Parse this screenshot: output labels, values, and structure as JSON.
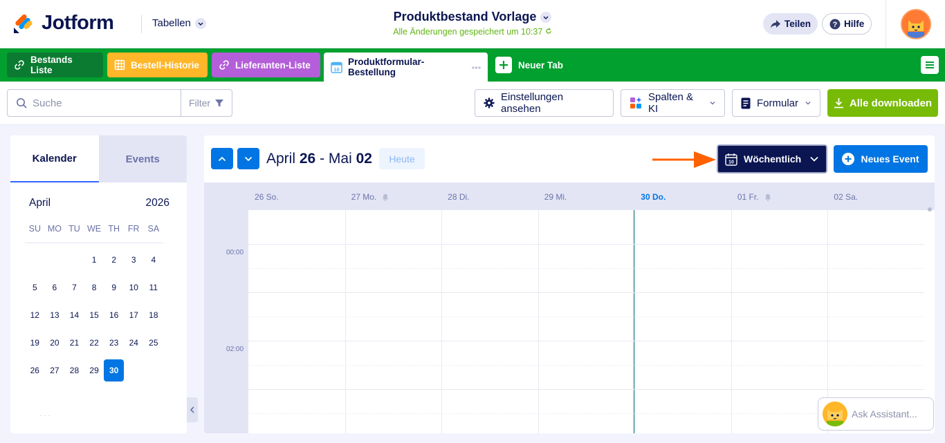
{
  "header": {
    "logo_text": "Jotform",
    "tables_label": "Tabellen",
    "title": "Produktbestand Vorlage",
    "saved_status": "Alle Änderungen gespeichert um 10:37",
    "share_label": "Teilen",
    "help_label": "Hilfe"
  },
  "tabs": [
    {
      "label": "Bestands Liste",
      "icon": "link-icon"
    },
    {
      "label": "Bestell-Historie",
      "icon": "grid-icon"
    },
    {
      "label": "Lieferanten-Liste",
      "icon": "link-icon"
    },
    {
      "label": "Produktformular-Bestellung",
      "icon": "calendar-icon"
    }
  ],
  "new_tab_label": "Neuer Tab",
  "toolbar": {
    "search_placeholder": "Suche",
    "filter_label": "Filter",
    "settings_label": "Einstellungen ansehen",
    "columns_label": "Spalten & KI",
    "form_label": "Formular",
    "download_label": "Alle downloaden"
  },
  "sidebar": {
    "tab_calendar": "Kalender",
    "tab_events": "Events",
    "month": "April",
    "year": "2026",
    "weekdays": [
      "SU",
      "MO",
      "TU",
      "WE",
      "TH",
      "FR",
      "SA"
    ],
    "days": [
      "",
      "",
      "",
      "1",
      "2",
      "3",
      "4",
      "5",
      "6",
      "7",
      "8",
      "9",
      "10",
      "11",
      "12",
      "13",
      "14",
      "15",
      "16",
      "17",
      "18",
      "19",
      "20",
      "21",
      "22",
      "23",
      "24",
      "25",
      "26",
      "27",
      "28",
      "29",
      "30"
    ],
    "today": "30"
  },
  "calendar": {
    "range_month_start": "April",
    "range_day_start": "26",
    "range_sep": "-",
    "range_month_end": "Mai",
    "range_day_end": "02",
    "today_label": "Heute",
    "view_label": "Wöchentlich",
    "new_event_label": "Neues Event",
    "day_headers": [
      {
        "label": "26 So.",
        "bell": false,
        "today": false
      },
      {
        "label": "27 Mo.",
        "bell": true,
        "today": false
      },
      {
        "label": "28 Di.",
        "bell": false,
        "today": false
      },
      {
        "label": "29 Mi.",
        "bell": false,
        "today": false
      },
      {
        "label": "30 Do.",
        "bell": false,
        "today": true
      },
      {
        "label": "01 Fr.",
        "bell": true,
        "today": false
      },
      {
        "label": "02 Sa.",
        "bell": false,
        "today": false
      }
    ],
    "hours": [
      "00:00",
      "02:00"
    ]
  },
  "assistant_label": "Ask Assistant...",
  "colors": {
    "brand_navy": "#0a1551",
    "tabbar_green": "#01a02f",
    "primary_blue": "#0075e3",
    "download_green": "#78bb07",
    "arrow_orange": "#ff6100"
  }
}
